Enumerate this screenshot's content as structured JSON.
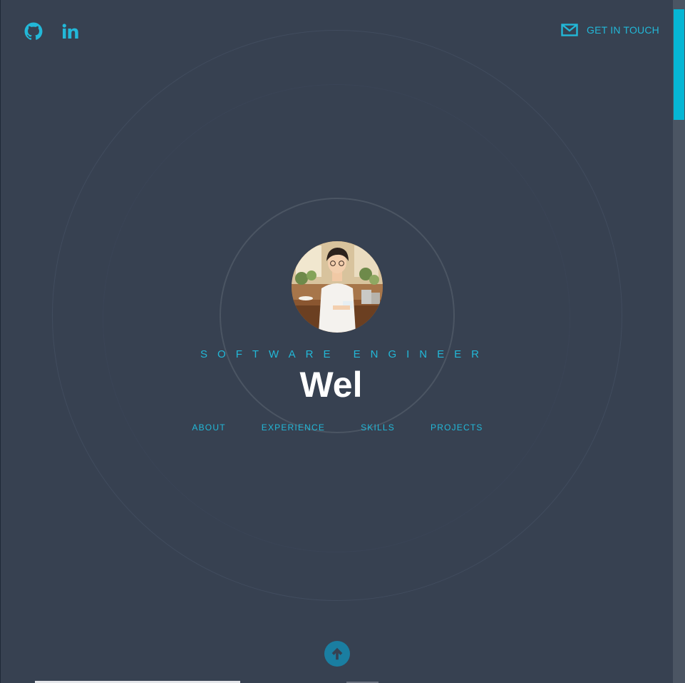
{
  "header": {
    "social": [
      {
        "icon": "github-icon"
      },
      {
        "icon": "linkedin-icon"
      }
    ],
    "contact_label": "GET IN TOUCH",
    "contact_icon": "mail-icon"
  },
  "hero": {
    "subtitle": "SOFTWARE ENGINEER",
    "name": "Wel",
    "nav": [
      {
        "label": "ABOUT"
      },
      {
        "label": "EXPERIENCE"
      },
      {
        "label": "SKILLS"
      },
      {
        "label": "PROJECTS"
      }
    ]
  },
  "footer": {
    "scroll_icon": "arrow-up-icon"
  },
  "colors": {
    "background": "#374151",
    "accent": "#22b8d8",
    "name_text": "#ffffff",
    "scroll_button": "#1a7ea1",
    "scrollbar_thumb": "#06b6d4"
  }
}
